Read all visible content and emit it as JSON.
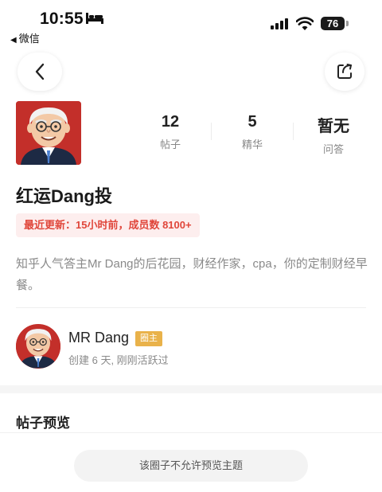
{
  "status_bar": {
    "time": "10:55",
    "back_app": "微信",
    "battery": "76"
  },
  "circle": {
    "name": "红运Dang投",
    "update_badge": "最近更新：15小时前，成员数 8100+",
    "description": "知乎人气答主Mr Dang的后花园，财经作家，cpa，你的定制财经早餐。"
  },
  "stats": [
    {
      "value": "12",
      "label": "帖子"
    },
    {
      "value": "5",
      "label": "精华"
    },
    {
      "value": "暂无",
      "label": "问答"
    }
  ],
  "owner": {
    "name": "MR Dang",
    "tag": "圈主",
    "meta": "创建 6 天, 刚刚活跃过"
  },
  "posts_section": {
    "title": "帖子预览",
    "notice": "该圈子不允许预览主题"
  },
  "colors": {
    "accent_red": "#e0463a",
    "badge_bg": "#fdeeee",
    "owner_tag": "#e9b24a",
    "avatar_bg": "#c32f2a"
  },
  "icons": [
    "bed-icon",
    "signal-icon",
    "wifi-icon",
    "battery-icon",
    "back-arrow-icon",
    "share-icon"
  ]
}
